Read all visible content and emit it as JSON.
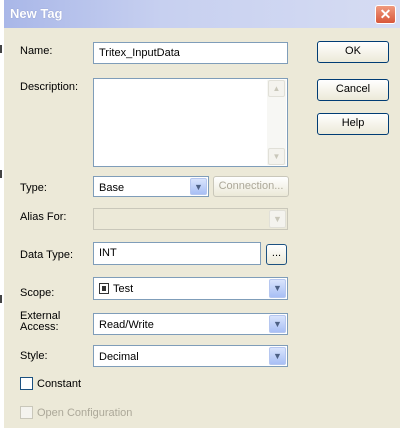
{
  "window": {
    "title": "New Tag"
  },
  "buttons": {
    "ok": "OK",
    "cancel": "Cancel",
    "help": "Help",
    "ellipsis": "...",
    "connection": "Connection..."
  },
  "labels": {
    "name": "Name:",
    "description": "Description:",
    "type": "Type:",
    "alias_for": "Alias For:",
    "data_type": "Data Type:",
    "scope": "Scope:",
    "external_access_1": "External",
    "external_access_2": "Access:",
    "style": "Style:"
  },
  "fields": {
    "name": "Tritex_InputData",
    "description": "",
    "type": "Base",
    "alias_for": "",
    "data_type": "INT",
    "scope": "Test",
    "external_access": "Read/Write",
    "style": "Decimal"
  },
  "checkboxes": {
    "constant": {
      "label": "Constant",
      "checked": false
    },
    "open_configuration": {
      "label": "Open Configuration",
      "checked": false
    }
  },
  "icons": {
    "close": "close-icon",
    "dropdown": "chevron-down-icon",
    "scope": "controller-icon"
  },
  "colors": {
    "title_gradient_start": "#a9b7e8",
    "close_button": "#d8573a",
    "dialog_bg": "#ece9d8"
  }
}
